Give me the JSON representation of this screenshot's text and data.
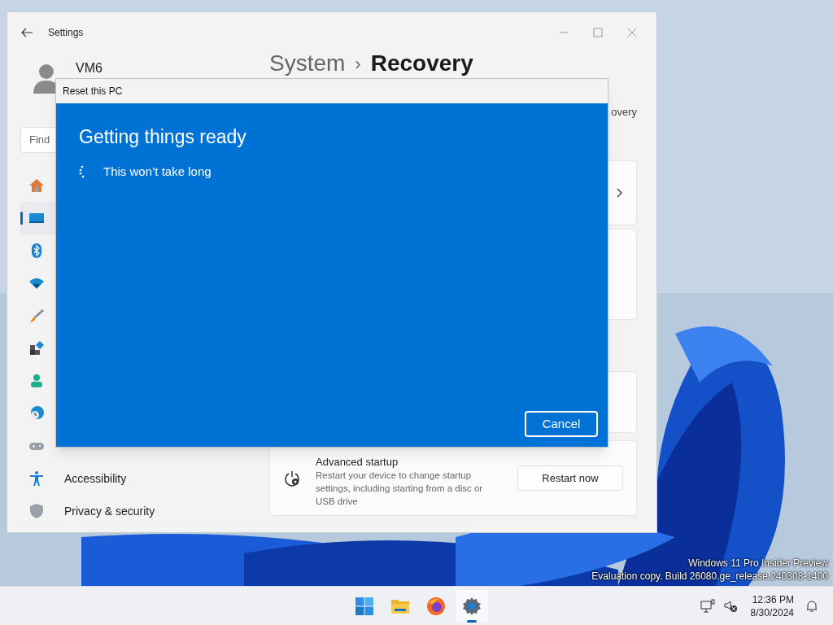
{
  "settings": {
    "title": "Settings",
    "user": "VM6",
    "search": {
      "placeholder": "Find"
    },
    "breadcrumb": [
      "System",
      "Recovery"
    ],
    "separator": "›",
    "subtitle": "overy",
    "nav": [
      {
        "kind": "home",
        "selected": false
      },
      {
        "kind": "system",
        "selected": true
      },
      {
        "kind": "bluetooth",
        "selected": false
      },
      {
        "kind": "network",
        "selected": false
      },
      {
        "kind": "personalization",
        "selected": false
      },
      {
        "kind": "apps",
        "selected": false
      },
      {
        "kind": "accounts",
        "selected": false
      },
      {
        "kind": "time",
        "selected": false
      },
      {
        "kind": "gaming",
        "selected": false
      },
      {
        "kind": "accessibility",
        "label": "Accessibility",
        "selected": false
      },
      {
        "kind": "privacy",
        "label": "Privacy & security",
        "selected": false
      }
    ],
    "advanced_startup": {
      "title": "Advanced startup",
      "description": "Restart your device to change startup settings, including starting from a disc or USB drive",
      "button": "Restart now"
    }
  },
  "dialog": {
    "title": "Reset this PC",
    "heading": "Getting things ready",
    "status": "This won’t take long",
    "button": "Cancel"
  },
  "watermark": [
    "Windows 11 Pro Insider Preview",
    "Evaluation copy. Build 26080.ge_release.240308-1400"
  ],
  "taskbar": {
    "apps": [
      {
        "kind": "start",
        "selected": false
      },
      {
        "kind": "files",
        "selected": false
      },
      {
        "kind": "browser",
        "selected": false
      },
      {
        "kind": "settings",
        "selected": true
      }
    ],
    "time": "12:36 PM",
    "date": "8/30/2024"
  }
}
